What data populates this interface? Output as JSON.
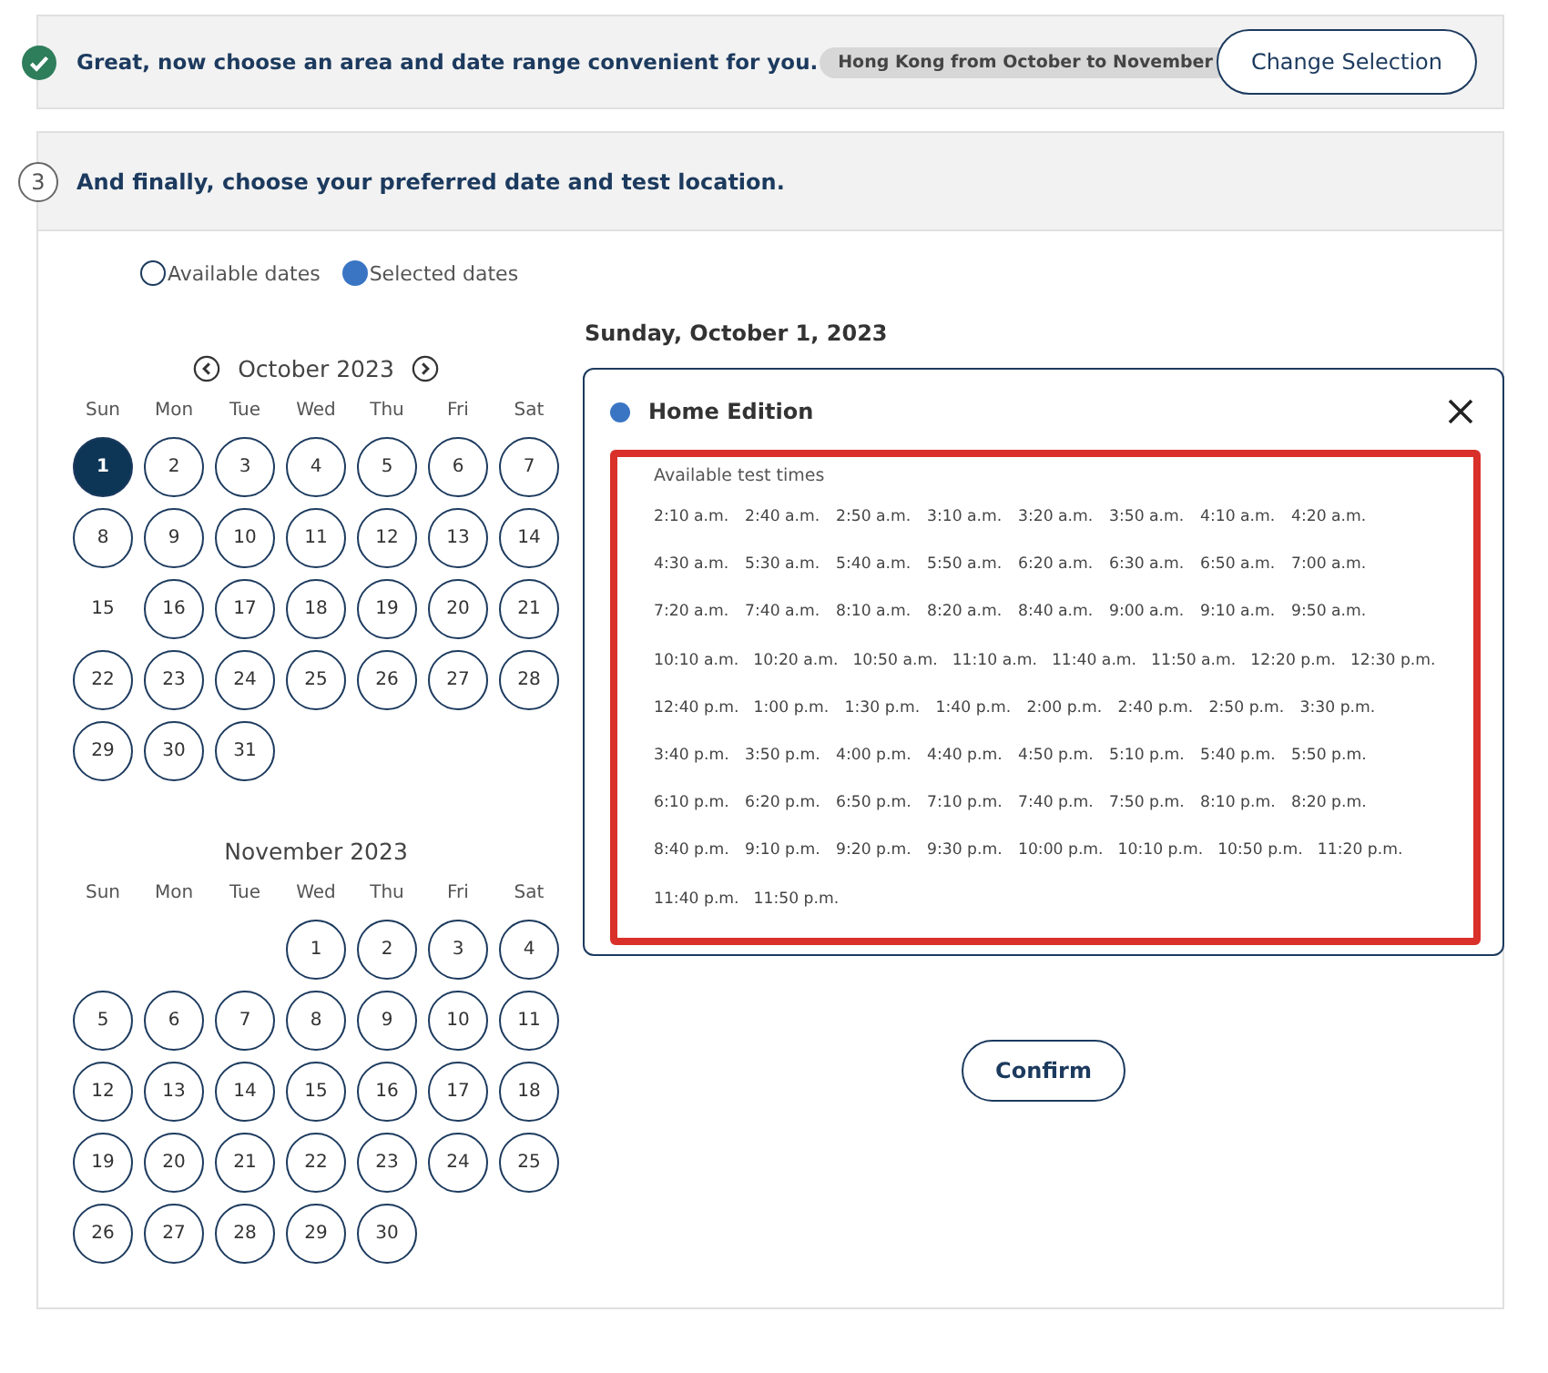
{
  "step_done": {
    "message": "Great, now choose an area and date range convenient for you.",
    "summary": "Hong Kong from October to November",
    "button": "Change Selection"
  },
  "step_current": {
    "number": "3",
    "message": "And finally, choose your preferred date and test location."
  },
  "legend": [
    {
      "kind": "available",
      "label": "Available dates"
    },
    {
      "kind": "selected",
      "label": "Selected dates"
    }
  ],
  "calendars": [
    {
      "title": "October 2023",
      "nav": true,
      "weekdays": [
        "Sun",
        "Mon",
        "Tue",
        "Wed",
        "Thu",
        "Fri",
        "Sat"
      ],
      "days": [
        {
          "kind": "day",
          "label": "1",
          "available": true,
          "selected": true
        },
        {
          "kind": "day",
          "label": "2",
          "available": true,
          "selected": false
        },
        {
          "kind": "day",
          "label": "3",
          "available": true,
          "selected": false
        },
        {
          "kind": "day",
          "label": "4",
          "available": true,
          "selected": false
        },
        {
          "kind": "day",
          "label": "5",
          "available": true,
          "selected": false
        },
        {
          "kind": "day",
          "label": "6",
          "available": true,
          "selected": false
        },
        {
          "kind": "day",
          "label": "7",
          "available": true,
          "selected": false
        },
        {
          "kind": "day",
          "label": "8",
          "available": true,
          "selected": false
        },
        {
          "kind": "day",
          "label": "9",
          "available": true,
          "selected": false
        },
        {
          "kind": "day",
          "label": "10",
          "available": true,
          "selected": false
        },
        {
          "kind": "day",
          "label": "11",
          "available": true,
          "selected": false
        },
        {
          "kind": "day",
          "label": "12",
          "available": true,
          "selected": false
        },
        {
          "kind": "day",
          "label": "13",
          "available": true,
          "selected": false
        },
        {
          "kind": "day",
          "label": "14",
          "available": true,
          "selected": false
        },
        {
          "kind": "day",
          "label": "15",
          "available": false,
          "selected": false
        },
        {
          "kind": "day",
          "label": "16",
          "available": true,
          "selected": false
        },
        {
          "kind": "day",
          "label": "17",
          "available": true,
          "selected": false
        },
        {
          "kind": "day",
          "label": "18",
          "available": true,
          "selected": false
        },
        {
          "kind": "day",
          "label": "19",
          "available": true,
          "selected": false
        },
        {
          "kind": "day",
          "label": "20",
          "available": true,
          "selected": false
        },
        {
          "kind": "day",
          "label": "21",
          "available": true,
          "selected": false
        },
        {
          "kind": "day",
          "label": "22",
          "available": true,
          "selected": false
        },
        {
          "kind": "day",
          "label": "23",
          "available": true,
          "selected": false
        },
        {
          "kind": "day",
          "label": "24",
          "available": true,
          "selected": false
        },
        {
          "kind": "day",
          "label": "25",
          "available": true,
          "selected": false
        },
        {
          "kind": "day",
          "label": "26",
          "available": true,
          "selected": false
        },
        {
          "kind": "day",
          "label": "27",
          "available": true,
          "selected": false
        },
        {
          "kind": "day",
          "label": "28",
          "available": true,
          "selected": false
        },
        {
          "kind": "day",
          "label": "29",
          "available": true,
          "selected": false
        },
        {
          "kind": "day",
          "label": "30",
          "available": true,
          "selected": false
        },
        {
          "kind": "day",
          "label": "31",
          "available": true,
          "selected": false
        }
      ]
    },
    {
      "title": "November 2023",
      "nav": false,
      "weekdays": [
        "Sun",
        "Mon",
        "Tue",
        "Wed",
        "Thu",
        "Fri",
        "Sat"
      ],
      "days": [
        {
          "kind": "empty"
        },
        {
          "kind": "empty"
        },
        {
          "kind": "empty"
        },
        {
          "kind": "day",
          "label": "1",
          "available": true,
          "selected": false
        },
        {
          "kind": "day",
          "label": "2",
          "available": true,
          "selected": false
        },
        {
          "kind": "day",
          "label": "3",
          "available": true,
          "selected": false
        },
        {
          "kind": "day",
          "label": "4",
          "available": true,
          "selected": false
        },
        {
          "kind": "day",
          "label": "5",
          "available": true,
          "selected": false
        },
        {
          "kind": "day",
          "label": "6",
          "available": true,
          "selected": false
        },
        {
          "kind": "day",
          "label": "7",
          "available": true,
          "selected": false
        },
        {
          "kind": "day",
          "label": "8",
          "available": true,
          "selected": false
        },
        {
          "kind": "day",
          "label": "9",
          "available": true,
          "selected": false
        },
        {
          "kind": "day",
          "label": "10",
          "available": true,
          "selected": false
        },
        {
          "kind": "day",
          "label": "11",
          "available": true,
          "selected": false
        },
        {
          "kind": "day",
          "label": "12",
          "available": true,
          "selected": false
        },
        {
          "kind": "day",
          "label": "13",
          "available": true,
          "selected": false
        },
        {
          "kind": "day",
          "label": "14",
          "available": true,
          "selected": false
        },
        {
          "kind": "day",
          "label": "15",
          "available": true,
          "selected": false
        },
        {
          "kind": "day",
          "label": "16",
          "available": true,
          "selected": false
        },
        {
          "kind": "day",
          "label": "17",
          "available": true,
          "selected": false
        },
        {
          "kind": "day",
          "label": "18",
          "available": true,
          "selected": false
        },
        {
          "kind": "day",
          "label": "19",
          "available": true,
          "selected": false
        },
        {
          "kind": "day",
          "label": "20",
          "available": true,
          "selected": false
        },
        {
          "kind": "day",
          "label": "21",
          "available": true,
          "selected": false
        },
        {
          "kind": "day",
          "label": "22",
          "available": true,
          "selected": false
        },
        {
          "kind": "day",
          "label": "23",
          "available": true,
          "selected": false
        },
        {
          "kind": "day",
          "label": "24",
          "available": true,
          "selected": false
        },
        {
          "kind": "day",
          "label": "25",
          "available": true,
          "selected": false
        },
        {
          "kind": "day",
          "label": "26",
          "available": true,
          "selected": false
        },
        {
          "kind": "day",
          "label": "27",
          "available": true,
          "selected": false
        },
        {
          "kind": "day",
          "label": "28",
          "available": true,
          "selected": false
        },
        {
          "kind": "day",
          "label": "29",
          "available": true,
          "selected": false
        },
        {
          "kind": "day",
          "label": "30",
          "available": true,
          "selected": false
        }
      ]
    }
  ],
  "selected_date": "Sunday, October 1, 2023",
  "location": {
    "name": "Home Edition",
    "color": "#3a75c4",
    "times_label": "Available test times",
    "highlighted": true,
    "times": [
      "2:10 a.m.",
      "2:40 a.m.",
      "2:50 a.m.",
      "3:10 a.m.",
      "3:20 a.m.",
      "3:50 a.m.",
      "4:10 a.m.",
      "4:20 a.m.",
      "4:30 a.m.",
      "5:30 a.m.",
      "5:40 a.m.",
      "5:50 a.m.",
      "6:20 a.m.",
      "6:30 a.m.",
      "6:50 a.m.",
      "7:00 a.m.",
      "7:20 a.m.",
      "7:40 a.m.",
      "8:10 a.m.",
      "8:20 a.m.",
      "8:40 a.m.",
      "9:00 a.m.",
      "9:10 a.m.",
      "9:50 a.m.",
      "10:10 a.m.",
      "10:20 a.m.",
      "10:50 a.m.",
      "11:10 a.m.",
      "11:40 a.m.",
      "11:50 a.m.",
      "12:20 p.m.",
      "12:30 p.m.",
      "12:40 p.m.",
      "1:00 p.m.",
      "1:30 p.m.",
      "1:40 p.m.",
      "2:00 p.m.",
      "2:40 p.m.",
      "2:50 p.m.",
      "3:30 p.m.",
      "3:40 p.m.",
      "3:50 p.m.",
      "4:00 p.m.",
      "4:40 p.m.",
      "4:50 p.m.",
      "5:10 p.m.",
      "5:40 p.m.",
      "5:50 p.m.",
      "6:10 p.m.",
      "6:20 p.m.",
      "6:50 p.m.",
      "7:10 p.m.",
      "7:40 p.m.",
      "7:50 p.m.",
      "8:10 p.m.",
      "8:20 p.m.",
      "8:40 p.m.",
      "9:10 p.m.",
      "9:20 p.m.",
      "9:30 p.m.",
      "10:00 p.m.",
      "10:10 p.m.",
      "10:50 p.m.",
      "11:20 p.m.",
      "11:40 p.m.",
      "11:50 p.m."
    ]
  },
  "confirm": "Confirm"
}
